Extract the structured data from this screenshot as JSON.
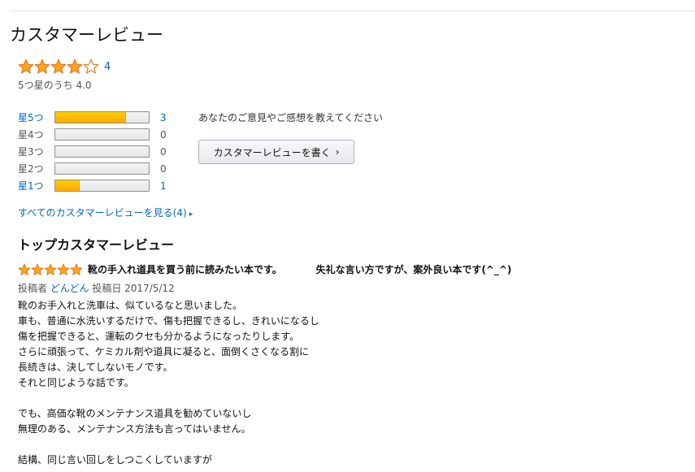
{
  "section_title": "カスタマーレビュー",
  "summary": {
    "rating": 4.0,
    "count": "4",
    "text": "5つ星のうち 4.0"
  },
  "histogram": [
    {
      "label": "星5つ",
      "count": "3",
      "fraction": 0.75,
      "linked": true
    },
    {
      "label": "星4つ",
      "count": "0",
      "fraction": 0.0,
      "linked": false
    },
    {
      "label": "星3つ",
      "count": "0",
      "fraction": 0.0,
      "linked": false
    },
    {
      "label": "星2つ",
      "count": "0",
      "fraction": 0.0,
      "linked": false
    },
    {
      "label": "星1つ",
      "count": "1",
      "fraction": 0.25,
      "linked": true
    }
  ],
  "share": {
    "prompt": "あなたのご意見やご感想を教えてください",
    "button_label": "カスタマーレビューを書く",
    "button_icon": "chevron-right-icon"
  },
  "all_reviews_link": "すべてのカスタマーレビューを見る(4)",
  "top_reviews_title": "トップカスタマーレビュー",
  "review": {
    "rating": 5,
    "title": "靴の手入れ道具を買う前に読みたい本です。          失礼な言い方ですが、案外良い本です(^_^)",
    "by_label": "投稿者",
    "author": "どんどん",
    "date_label": "投稿日",
    "date": "2017/5/12",
    "body_lines": [
      "靴のお手入れと洗車は、似ているなと思いました。",
      "車も、普通に水洗いするだけで、傷も把握できるし、きれいになるし",
      "傷を把握できると、運転のクセも分かるようになったりします。",
      "さらに頑張って、ケミカル剤や道具に凝ると、面倒くさくなる割に",
      "長続きは、決してしないモノです。",
      "それと同じような話です。",
      "",
      "でも、高価な靴のメンテナンス道具を勧めていないし",
      "無理のある、メンテナンス方法も言ってはいません。",
      "",
      "結構、同じ言い回しをしつこくしていますが"
    ]
  },
  "colors": {
    "star": "#ffa41c",
    "star_outline": "#de7921",
    "link": "#0066c0",
    "bar_fill": "#ffa700"
  }
}
